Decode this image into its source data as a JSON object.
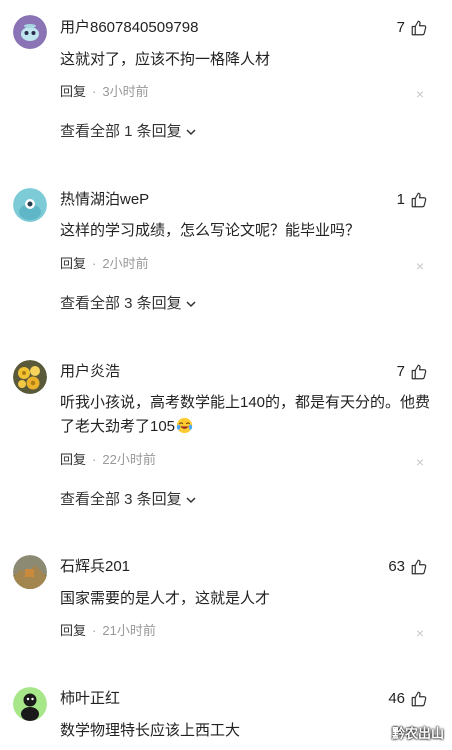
{
  "comments": [
    {
      "username": "用户8607840509798",
      "likes": "7",
      "content": "这就对了，应该不拘一格降人材",
      "reply_label": "回复",
      "dot": "·",
      "time": "3小时前",
      "close": "×",
      "view_all": "查看全部 1 条回复",
      "avatar_icon": "alien-avatar-icon"
    },
    {
      "username": "热情湖泊weP",
      "likes": "1",
      "content": "这样的学习成绩，怎么写论文呢？能毕业吗？",
      "reply_label": "回复",
      "dot": "·",
      "time": "2小时前",
      "close": "×",
      "view_all": "查看全部 3 条回复",
      "avatar_icon": "cyan-bird-avatar-icon"
    },
    {
      "username": "用户炎浩",
      "likes": "7",
      "content": "听我小孩说，高考数学能上140的，都是有天分的。他费了老大劲考了105",
      "emoji": "crying-laughing-emoji",
      "reply_label": "回复",
      "dot": "·",
      "time": "22小时前",
      "close": "×",
      "view_all": "查看全部 3 条回复",
      "avatar_icon": "flowers-avatar-icon"
    },
    {
      "username": "石辉兵201",
      "likes": "63",
      "content": "国家需要的是人才，这就是人才",
      "reply_label": "回复",
      "dot": "·",
      "time": "21小时前",
      "close": "×",
      "avatar_icon": "landscape-avatar-icon"
    },
    {
      "username": "柿叶正红",
      "likes": "46",
      "content": "数学物理特长应该上西工大",
      "avatar_icon": "black-figure-avatar-icon"
    }
  ],
  "watermark": "黔农出山",
  "icons": {
    "like": "thumbs-up-icon",
    "expand": "chevron-down-icon"
  },
  "colors": {
    "text": "#222222",
    "meta": "#999999",
    "close": "#c8c8c8"
  }
}
